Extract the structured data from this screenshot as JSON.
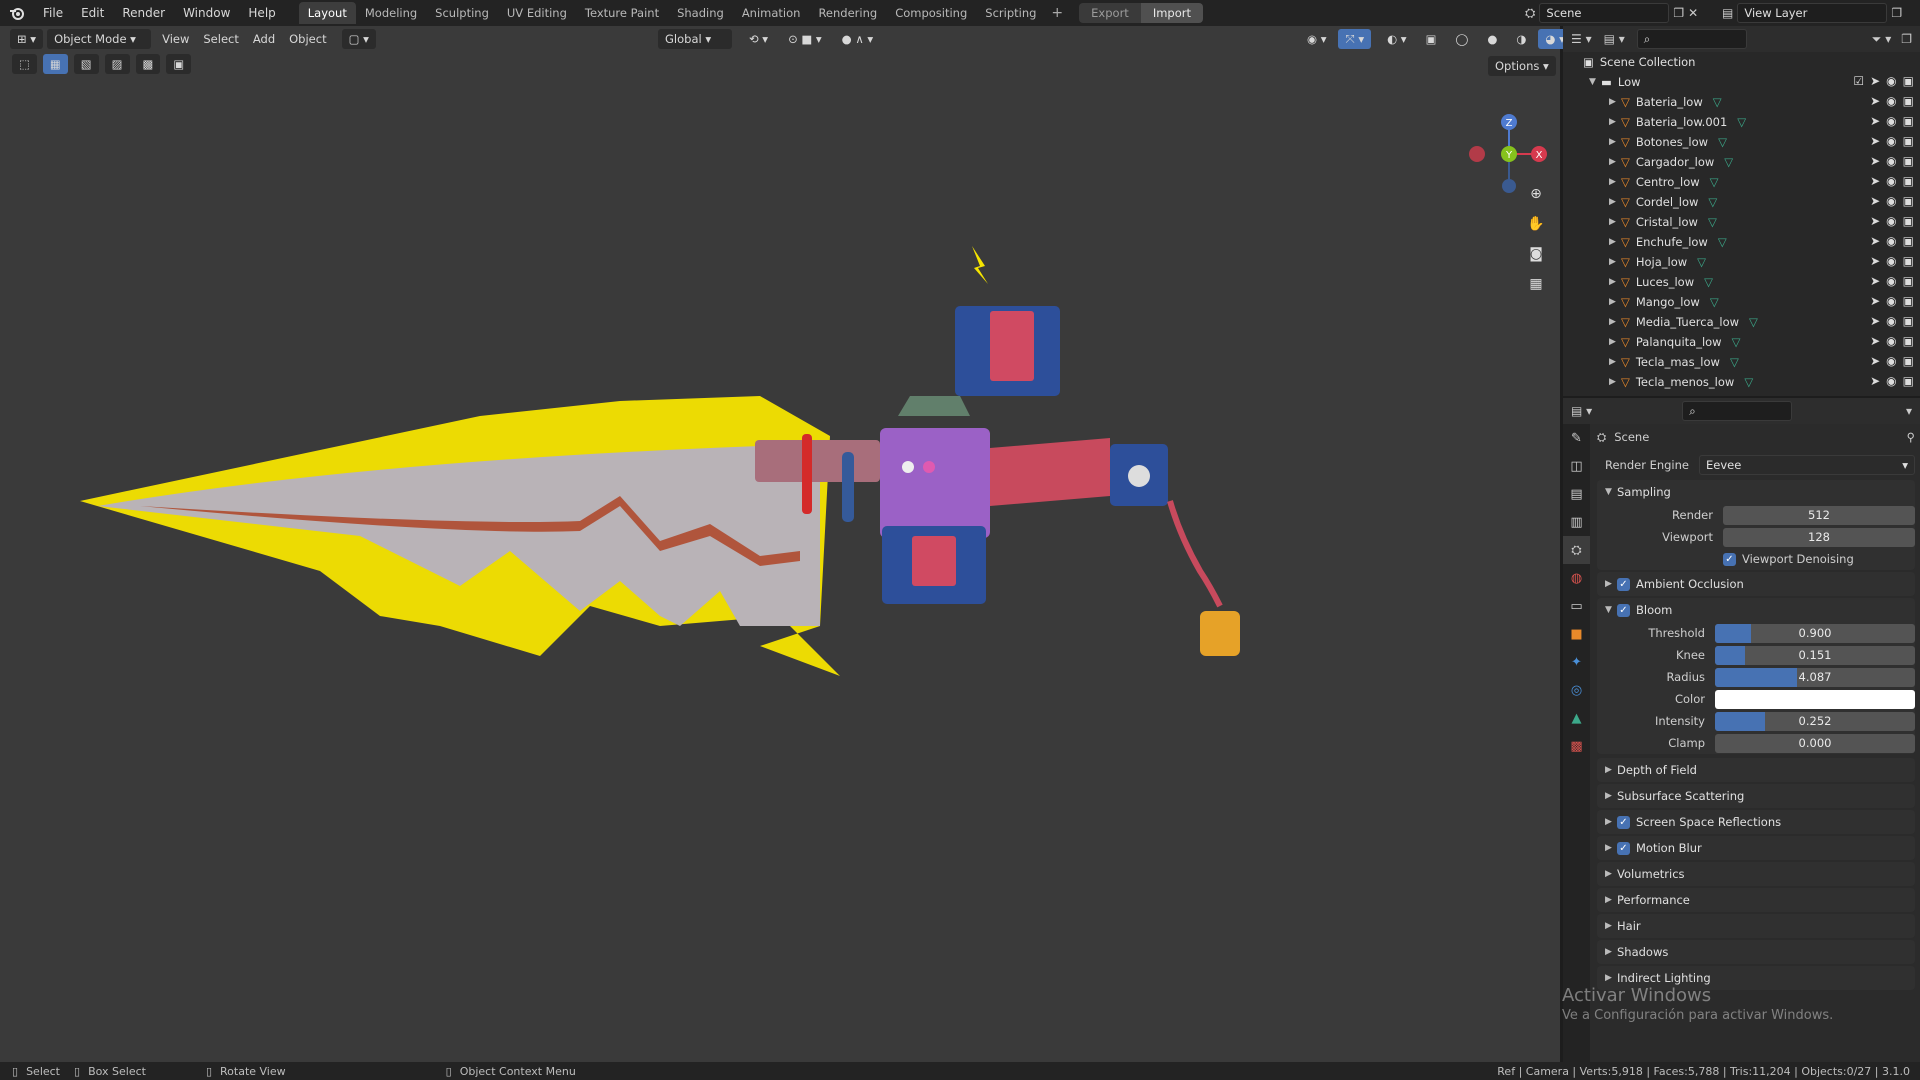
{
  "topbar": {
    "menus": [
      "File",
      "Edit",
      "Render",
      "Window",
      "Help"
    ],
    "tabs": [
      "Layout",
      "Modeling",
      "Sculpting",
      "UV Editing",
      "Texture Paint",
      "Shading",
      "Animation",
      "Rendering",
      "Compositing",
      "Scripting"
    ],
    "active_tab": "Layout",
    "export_label": "Export",
    "import_label": "Import",
    "scene_name": "Scene",
    "view_layer": "View Layer"
  },
  "viewport": {
    "mode": "Object Mode",
    "menus": [
      "View",
      "Select",
      "Add",
      "Object"
    ],
    "transform_orientation": "Global",
    "options_label": "Options",
    "gizmo": {
      "z": "Z",
      "y": "Y",
      "x": "X"
    }
  },
  "outliner": {
    "root": "Scene Collection",
    "collection": "Low",
    "objects": [
      "Bateria_low",
      "Bateria_low.001",
      "Botones_low",
      "Cargador_low",
      "Centro_low",
      "Cordel_low",
      "Cristal_low",
      "Enchufe_low",
      "Hoja_low",
      "Luces_low",
      "Mango_low",
      "Media_Tuerca_low",
      "Palanquita_low",
      "Tecla_mas_low",
      "Tecla_menos_low"
    ]
  },
  "properties": {
    "context": "Scene",
    "render_engine_label": "Render Engine",
    "render_engine": "Eevee",
    "sampling": {
      "title": "Sampling",
      "render_label": "Render",
      "render": "512",
      "viewport_label": "Viewport",
      "viewport": "128",
      "denoise": "Viewport Denoising"
    },
    "ambient_occlusion": "Ambient Occlusion",
    "bloom": {
      "title": "Bloom",
      "threshold_label": "Threshold",
      "threshold": "0.900",
      "threshold_fill": 0.18,
      "knee_label": "Knee",
      "knee": "0.151",
      "knee_fill": 0.15,
      "radius_label": "Radius",
      "radius": "4.087",
      "radius_fill": 0.41,
      "color_label": "Color",
      "color": "#ffffff",
      "intensity_label": "Intensity",
      "intensity": "0.252",
      "intensity_fill": 0.25,
      "clamp_label": "Clamp",
      "clamp": "0.000"
    },
    "sections": [
      "Depth of Field",
      "Subsurface Scattering",
      "Screen Space Reflections",
      "Motion Blur",
      "Volumetrics",
      "Performance",
      "Hair",
      "Shadows",
      "Indirect Lighting"
    ],
    "checked_sections": [
      "Screen Space Reflections",
      "Motion Blur"
    ]
  },
  "statusbar": {
    "select": "Select",
    "box_select": "Box Select",
    "rotate": "Rotate View",
    "context_menu": "Object Context Menu",
    "stats": "Ref | Camera | Verts:5,918 | Faces:5,788 | Tris:11,204 | Objects:0/27 | 3.1.0"
  },
  "watermark": {
    "title": "Activar Windows",
    "sub": "Ve a Configuración para activar Windows."
  },
  "colors": {
    "accent": "#4772b3",
    "glow": "#f5e400",
    "bg": "#3a3a3a"
  }
}
